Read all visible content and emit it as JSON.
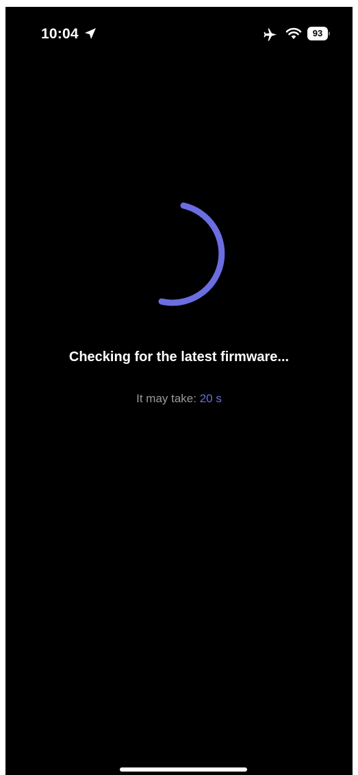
{
  "status_bar": {
    "time": "10:04",
    "battery_level": "93",
    "icons": [
      "location-arrow-icon",
      "airplane-mode-icon",
      "wifi-icon",
      "battery-icon"
    ]
  },
  "loader": {
    "title": "Checking for the latest firmware...",
    "eta_label": "It may take:",
    "eta_value": "20 s"
  },
  "colors": {
    "background": "#000000",
    "accent": "#6b6ee0",
    "primary_text": "#ffffff",
    "secondary_text": "#9b9b9f"
  }
}
